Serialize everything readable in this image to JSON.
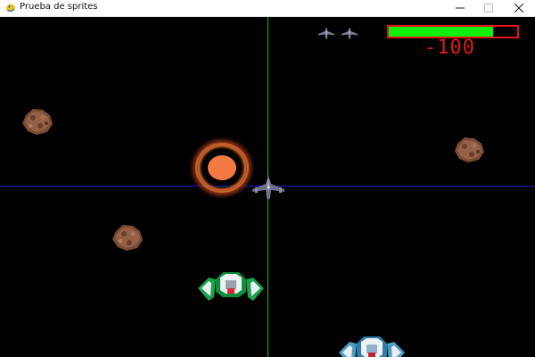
{
  "window": {
    "title": "Prueba de sprites",
    "app_icon": "pygame-snake-icon",
    "buttons": {
      "minimize_icon": "minimize-icon",
      "maximize_icon": "maximize-icon",
      "close_icon": "close-icon"
    }
  },
  "hud": {
    "score": "-100",
    "health_fraction": 0.81,
    "lives_remaining": 2,
    "colors": {
      "health_fill": "#0ef00e",
      "health_border": "#e21414",
      "score": "#e01818"
    }
  },
  "scene": {
    "colors": {
      "background": "#000000",
      "vertical_axis": "#10c010",
      "horizontal_axis": "#1a1acd"
    },
    "sprites": [
      "asteroid",
      "asteroid",
      "asteroid",
      "explosion-ring",
      "player-ship",
      "enemy-ship-green",
      "enemy-ship-blue"
    ]
  }
}
